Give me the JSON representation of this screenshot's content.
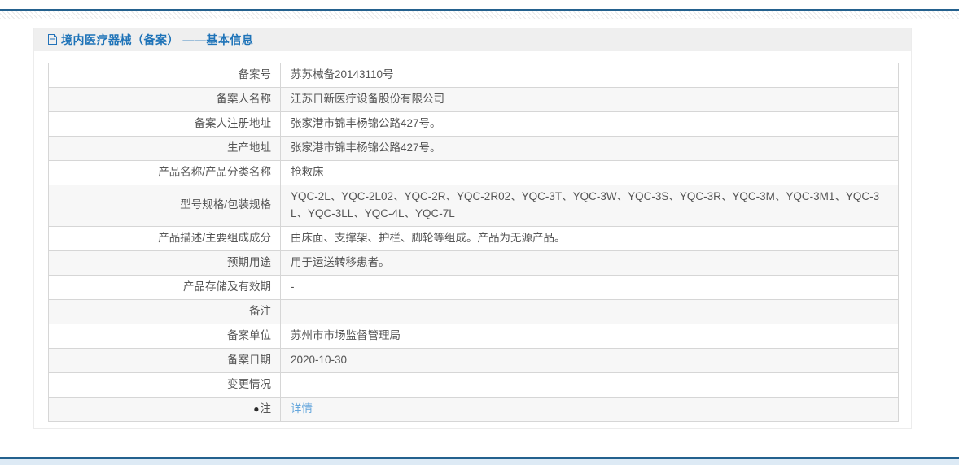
{
  "header": {
    "title": "境内医疗器械（备案） ——基本信息"
  },
  "colors": {
    "title_blue": "#1e73b8",
    "link_blue": "#64a6dc",
    "divider_line_blue": "#24618e",
    "footer_strip_blue": "#ddeaf5",
    "panel_header_bg": "#efefef",
    "row_alt_bg": "#f7f7f7",
    "table_border": "#d6d6d6",
    "text_gray": "#555555"
  },
  "table": {
    "rows": [
      {
        "label": "备案号",
        "value": "苏苏械备20143110号"
      },
      {
        "label": "备案人名称",
        "value": "江苏日新医疗设备股份有限公司"
      },
      {
        "label": "备案人注册地址",
        "value": "张家港市锦丰杨锦公路427号。"
      },
      {
        "label": "生产地址",
        "value": "张家港市锦丰杨锦公路427号。"
      },
      {
        "label": "产品名称/产品分类名称",
        "value": "抢救床"
      },
      {
        "label": "型号规格/包装规格",
        "value": "YQC-2L、YQC-2L02、YQC-2R、YQC-2R02、YQC-3T、YQC-3W、YQC-3S、YQC-3R、YQC-3M、YQC-3M1、YQC-3L、YQC-3LL、YQC-4L、YQC-7L"
      },
      {
        "label": "产品描述/主要组成成分",
        "value": "由床面、支撑架、护栏、脚轮等组成。产品为无源产品。"
      },
      {
        "label": "预期用途",
        "value": "用于运送转移患者。"
      },
      {
        "label": "产品存储及有效期",
        "value": "-"
      },
      {
        "label": "备注",
        "value": ""
      },
      {
        "label": "备案单位",
        "value": "苏州市市场监督管理局"
      },
      {
        "label": "备案日期",
        "value": "2020-10-30"
      },
      {
        "label": "变更情况",
        "value": ""
      },
      {
        "label": "注",
        "label_icon": "note-icon",
        "label_icon_glyph": "●",
        "value": "详情",
        "link": true
      }
    ]
  }
}
